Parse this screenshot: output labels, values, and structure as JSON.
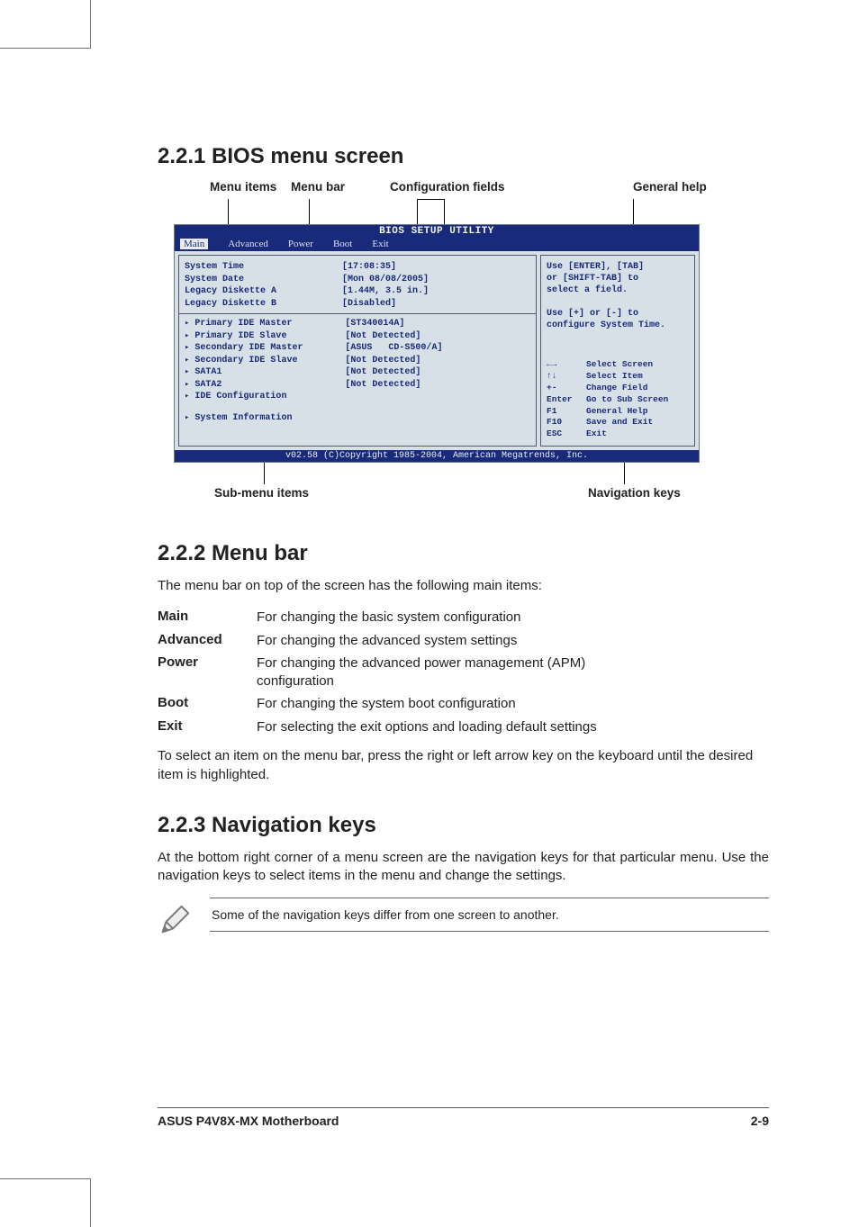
{
  "section_221_title": "2.2.1   BIOS menu screen",
  "section_222_title": "2.2.2   Menu bar",
  "section_223_title": "2.2.3   Navigation keys",
  "callouts": {
    "menu_items": "Menu items",
    "menu_bar": "Menu bar",
    "config_fields": "Configuration fields",
    "general_help": "General help",
    "submenu_items": "Sub-menu items",
    "nav_keys": "Navigation keys"
  },
  "bios": {
    "title": "BIOS SETUP UTILITY",
    "menubar": [
      "Main",
      "Advanced",
      "Power",
      "Boot",
      "Exit"
    ],
    "selected_tab": "Main",
    "fields": [
      {
        "label": "System Time",
        "value": "[17:08:35]"
      },
      {
        "label": "System Date",
        "value": "[Mon 08/08/2005]"
      },
      {
        "label": "Legacy Diskette A",
        "value": "[1.44M, 3.5 in.]"
      },
      {
        "label": "Legacy Diskette B",
        "value": "[Disabled]"
      }
    ],
    "submenus": [
      {
        "label": "Primary IDE Master",
        "value": "[ST340014A]"
      },
      {
        "label": "Primary IDE Slave",
        "value": "[Not Detected]"
      },
      {
        "label": "Secondary IDE Master",
        "value": "[ASUS   CD-S500/A]"
      },
      {
        "label": "Secondary IDE Slave",
        "value": "[Not Detected]"
      },
      {
        "label": "SATA1",
        "value": "[Not Detected]"
      },
      {
        "label": "SATA2",
        "value": "[Not Detected]"
      },
      {
        "label": "IDE Configuration",
        "value": ""
      }
    ],
    "sysinfo_label": "System Information",
    "help_text": "Use [ENTER], [TAB]\nor [SHIFT-TAB] to\nselect a field.\n\nUse [+] or [-] to\nconfigure System Time.",
    "nav": [
      {
        "key": "←→",
        "action": "Select Screen"
      },
      {
        "key": "↑↓",
        "action": "Select Item"
      },
      {
        "key": "+-",
        "action": "Change Field"
      },
      {
        "key": "Enter",
        "action": "Go to Sub Screen"
      },
      {
        "key": "F1",
        "action": "General Help"
      },
      {
        "key": "F10",
        "action": "Save and Exit"
      },
      {
        "key": "ESC",
        "action": "Exit"
      }
    ],
    "footer": "v02.58 (C)Copyright 1985-2004, American Megatrends, Inc."
  },
  "menubar_intro": "The menu bar on top of the screen has the following main items:",
  "menubar_items": [
    {
      "name": "Main",
      "desc": "For changing the basic system configuration"
    },
    {
      "name": "Advanced",
      "desc": "For changing the advanced system settings"
    },
    {
      "name": "Power",
      "desc": "For changing the advanced power management (APM) configuration"
    },
    {
      "name": "Boot",
      "desc": "For changing the system boot configuration"
    },
    {
      "name": "Exit",
      "desc": "For selecting the exit options and loading default settings"
    }
  ],
  "menubar_outro": "To select an item on the menu bar, press the right or left arrow key on the keyboard until the desired item is highlighted.",
  "navkeys_para": "At the bottom right corner of a menu screen are the navigation keys for that particular menu. Use the navigation keys to select items in the menu and change the settings.",
  "note_text": "Some of the navigation keys differ from one screen to another.",
  "footer_left": "ASUS P4V8X-MX Motherboard",
  "footer_right": "2-9"
}
